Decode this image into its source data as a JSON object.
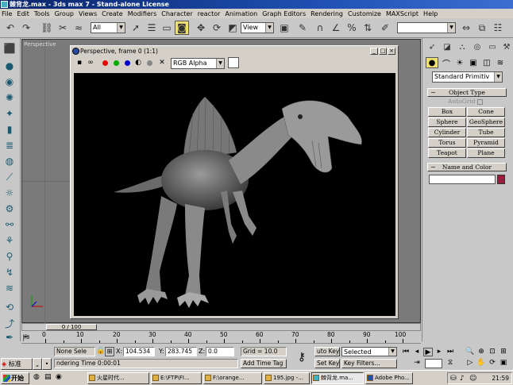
{
  "app": {
    "title": "棘背龙.max - 3ds max 7 - Stand-alone License"
  },
  "menu": [
    "File",
    "Edit",
    "Tools",
    "Group",
    "Views",
    "Create",
    "Modifiers",
    "Character",
    "reactor",
    "Animation",
    "Graph Editors",
    "Rendering",
    "Customize",
    "MAXScript",
    "Help"
  ],
  "toolbar": {
    "selection_filter": "All",
    "reference_coord": "View"
  },
  "viewport": {
    "label": "Perspective"
  },
  "frame_window": {
    "title": "Perspective, frame 0 (1:1)",
    "channel": "RGB Alpha",
    "minimize": "_",
    "maximize": "□",
    "close": "×"
  },
  "command_panel": {
    "category": "Standard Primitiv",
    "object_type_title": "Object Type",
    "autogrid": "AutoGrid",
    "primitives": [
      "Box",
      "Cone",
      "Sphere",
      "GeoSphere",
      "Cylinder",
      "Tube",
      "Torus",
      "Pyramid",
      "Teapot",
      "Plane"
    ],
    "name_color_title": "Name and Color",
    "object_color": "#9c1c3c"
  },
  "timeline": {
    "slider": "0 / 100",
    "ticks": [
      "0",
      "10",
      "20",
      "30",
      "40",
      "50",
      "60",
      "70",
      "80",
      "90",
      "100"
    ]
  },
  "status": {
    "selection": "None Sele",
    "x_label": "X:",
    "x": "104.534",
    "y_label": "Y:",
    "y": "283.745",
    "z_label": "Z:",
    "z": "0.0",
    "grid": "Grid = 10.0",
    "rendering": "ndering Time  0:00:01",
    "add_time_tag": "Add Time Tag",
    "auto_key": "uto Key",
    "set_key": "Set Key",
    "key_mode": "Selected",
    "key_filters": "Key Filters..."
  },
  "ime": {
    "lang": "标准",
    "sym": "„",
    "dot": "•"
  },
  "taskbar": {
    "start": "开始",
    "tasks": [
      "火星时代...",
      "E:\\FTP\\FI...",
      "F:\\orange...",
      "195.jpg -...",
      "棘背龙.ma...",
      "Adobe Pho..."
    ],
    "clock": "21:59"
  },
  "colors": {
    "title_bar": "#0a246a",
    "viewport_bg": "#7a7a7a",
    "active_button": "#f0e070"
  }
}
